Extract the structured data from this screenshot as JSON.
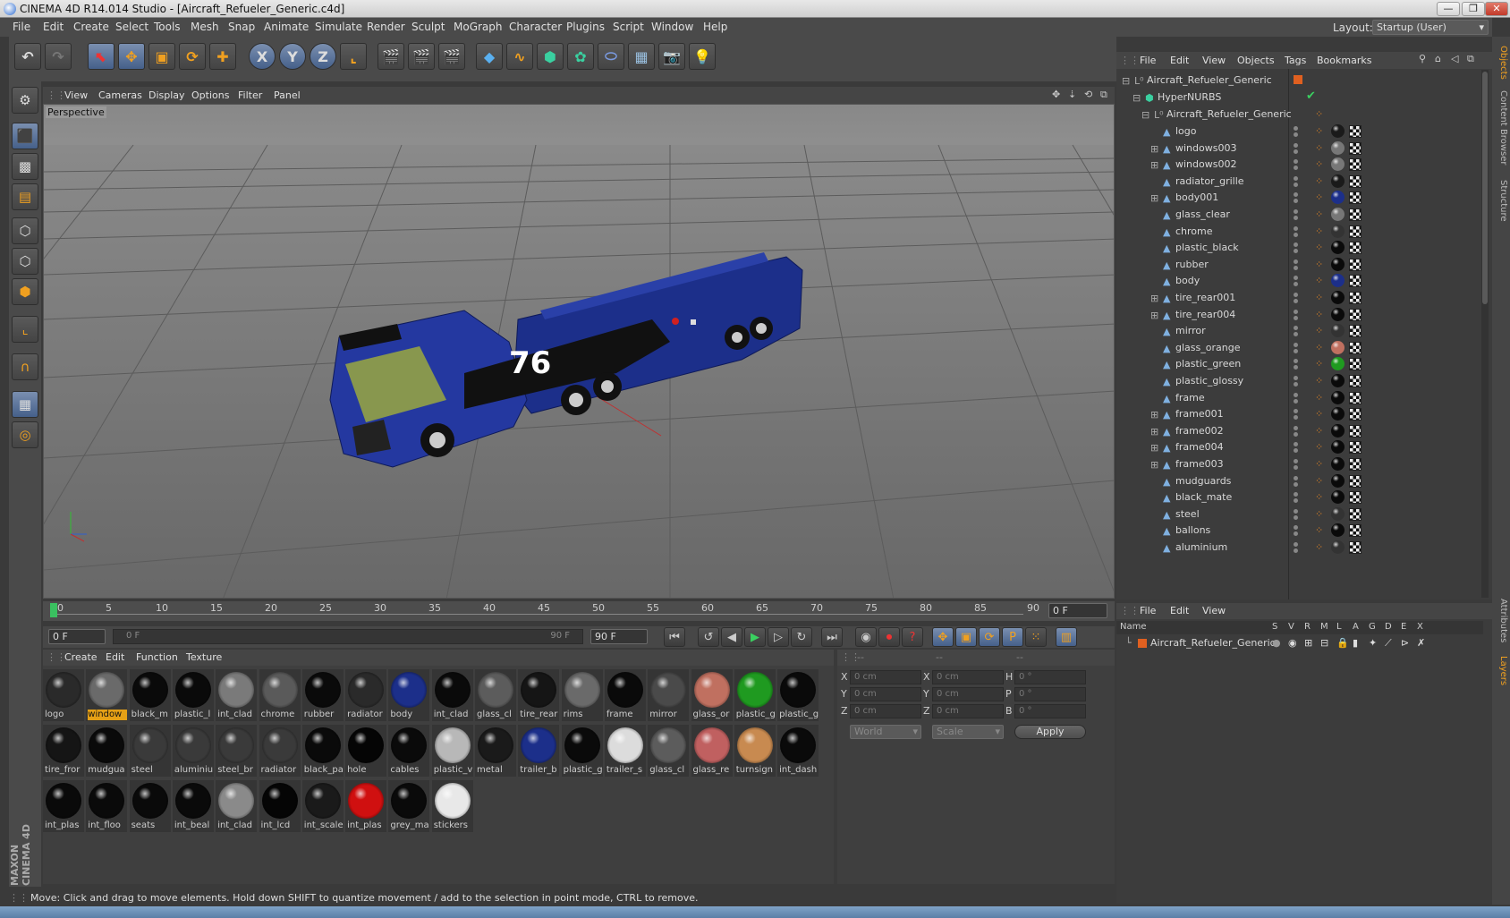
{
  "window": {
    "title": "CINEMA 4D R14.014 Studio - [Aircraft_Refueler_Generic.c4d]",
    "controls": [
      "—",
      "❐",
      "✕"
    ]
  },
  "menubar": {
    "items": [
      "File",
      "Edit",
      "Create",
      "Select",
      "Tools",
      "Mesh",
      "Snap",
      "Animate",
      "Simulate",
      "Render",
      "Sculpt",
      "MoGraph",
      "Character",
      "Plugins",
      "Script",
      "Window",
      "Help"
    ],
    "layout_label": "Layout:",
    "layout_value": "Startup (User)"
  },
  "toolbar": {
    "axis_x": "X",
    "axis_y": "Y",
    "axis_z": "Z"
  },
  "viewport": {
    "menu": [
      "View",
      "Cameras",
      "Display",
      "Options",
      "Filter",
      "Panel"
    ],
    "label": "Perspective",
    "truck_number": "76"
  },
  "timeline": {
    "ticks": [
      "0",
      "5",
      "10",
      "15",
      "20",
      "25",
      "30",
      "35",
      "40",
      "45",
      "50",
      "55",
      "60",
      "65",
      "70",
      "75",
      "80",
      "85",
      "90"
    ],
    "current_frame": "0 F",
    "start_field": "0 F",
    "range_start": "0 F",
    "range_end": "90 F",
    "end_field": "90 F"
  },
  "materials": {
    "menu": [
      "Create",
      "Edit",
      "Function",
      "Texture"
    ],
    "items": [
      {
        "label": "logo",
        "color": "#2a2a2a"
      },
      {
        "label": "window",
        "color": "#6a6a6a",
        "highlight": true
      },
      {
        "label": "black_m",
        "color": "#0a0a0a"
      },
      {
        "label": "plastic_l",
        "color": "#0a0a0a"
      },
      {
        "label": "int_clad",
        "color": "#7a7a7a"
      },
      {
        "label": "chrome",
        "color": "#5a5a5a"
      },
      {
        "label": "rubber",
        "color": "#0a0a0a"
      },
      {
        "label": "radiator",
        "color": "#2a2a2a"
      },
      {
        "label": "body",
        "color": "#1c2f8a"
      },
      {
        "label": "int_clad",
        "color": "#0a0a0a"
      },
      {
        "label": "glass_cl",
        "color": "#5c5c5c"
      },
      {
        "label": "tire_rear",
        "color": "#151515"
      },
      {
        "label": "rims",
        "color": "#6a6a6a"
      },
      {
        "label": "frame",
        "color": "#0a0a0a"
      },
      {
        "label": "mirror",
        "color": "#4a4a4a"
      },
      {
        "label": "glass_or",
        "color": "#c07060"
      },
      {
        "label": "plastic_g",
        "color": "#1f9a20"
      },
      {
        "label": "plastic_g",
        "color": "#0a0a0a"
      },
      {
        "label": "tire_fror",
        "color": "#151515"
      },
      {
        "label": "mudgua",
        "color": "#0a0a0a"
      },
      {
        "label": "steel",
        "color": "#3a3a3a"
      },
      {
        "label": "aluminiu",
        "color": "#3a3a3a"
      },
      {
        "label": "steel_br",
        "color": "#3a3a3a"
      },
      {
        "label": "radiator",
        "color": "#3a3a3a"
      },
      {
        "label": "black_pa",
        "color": "#0a0a0a"
      },
      {
        "label": "hole",
        "color": "#050505"
      },
      {
        "label": "cables",
        "color": "#0a0a0a"
      },
      {
        "label": "plastic_v",
        "color": "#b8b8b8"
      },
      {
        "label": "metal",
        "color": "#1a1a1a"
      },
      {
        "label": "trailer_b",
        "color": "#1c2f8a"
      },
      {
        "label": "plastic_g",
        "color": "#0a0a0a"
      },
      {
        "label": "trailer_s",
        "color": "#dcdcdc"
      },
      {
        "label": "glass_cl",
        "color": "#5c5c5c"
      },
      {
        "label": "glass_re",
        "color": "#c06060"
      },
      {
        "label": "turnsign",
        "color": "#c88a50"
      },
      {
        "label": "int_dash",
        "color": "#0a0a0a"
      },
      {
        "label": "int_plas",
        "color": "#0a0a0a"
      },
      {
        "label": "int_floo",
        "color": "#0a0a0a"
      },
      {
        "label": "seats",
        "color": "#0a0a0a"
      },
      {
        "label": "int_beal",
        "color": "#0a0a0a"
      },
      {
        "label": "int_clad",
        "color": "#8a8a8a"
      },
      {
        "label": "int_lcd",
        "color": "#050505"
      },
      {
        "label": "int_scale",
        "color": "#1a1a1a"
      },
      {
        "label": "int_plas",
        "color": "#d01010"
      },
      {
        "label": "grey_ma",
        "color": "#0a0a0a"
      },
      {
        "label": "stickers",
        "color": "#e8e8e8"
      }
    ]
  },
  "coordinates": {
    "headers": [
      "--",
      "--",
      "--"
    ],
    "rows": [
      {
        "a": "X",
        "av": "0 cm",
        "b": "X",
        "bv": "0 cm",
        "c": "H",
        "cv": "0 °"
      },
      {
        "a": "Y",
        "av": "0 cm",
        "b": "Y",
        "bv": "0 cm",
        "c": "P",
        "cv": "0 °"
      },
      {
        "a": "Z",
        "av": "0 cm",
        "b": "Z",
        "bv": "0 cm",
        "c": "B",
        "cv": "0 °"
      }
    ],
    "space": "World",
    "mode": "Scale",
    "apply": "Apply"
  },
  "objects": {
    "menu": [
      "File",
      "Edit",
      "View",
      "Objects",
      "Tags",
      "Bookmarks"
    ],
    "root": "Aircraft_Refueler_Generic",
    "hypernurbs": "HyperNURBS",
    "group": "Aircraft_Refueler_Generic",
    "items": [
      {
        "name": "logo",
        "tag": "#1a1a1a",
        "expand": false
      },
      {
        "name": "windows003",
        "tag": "#777",
        "expand": true
      },
      {
        "name": "windows002",
        "tag": "#777",
        "expand": true
      },
      {
        "name": "radiator_grille",
        "tag": "#1a1a1a",
        "expand": false
      },
      {
        "name": "body001",
        "tag": "#1c2f8a",
        "expand": true
      },
      {
        "name": "glass_clear",
        "tag": "#777",
        "expand": false
      },
      {
        "name": "chrome",
        "tag": "#333",
        "expand": false
      },
      {
        "name": "plastic_black",
        "tag": "#0a0a0a",
        "expand": false
      },
      {
        "name": "rubber",
        "tag": "#0a0a0a",
        "expand": false
      },
      {
        "name": "body",
        "tag": "#1c2f8a",
        "expand": false
      },
      {
        "name": "tire_rear001",
        "tag": "#0a0a0a",
        "expand": true
      },
      {
        "name": "tire_rear004",
        "tag": "#0a0a0a",
        "expand": true
      },
      {
        "name": "mirror",
        "tag": "#333",
        "expand": false
      },
      {
        "name": "glass_orange",
        "tag": "#c07060",
        "expand": false
      },
      {
        "name": "plastic_green",
        "tag": "#1f9a20",
        "expand": false
      },
      {
        "name": "plastic_glossy",
        "tag": "#0a0a0a",
        "expand": false
      },
      {
        "name": "frame",
        "tag": "#0a0a0a",
        "expand": false
      },
      {
        "name": "frame001",
        "tag": "#0a0a0a",
        "expand": true
      },
      {
        "name": "frame002",
        "tag": "#0a0a0a",
        "expand": true
      },
      {
        "name": "frame004",
        "tag": "#0a0a0a",
        "expand": true
      },
      {
        "name": "frame003",
        "tag": "#0a0a0a",
        "expand": true
      },
      {
        "name": "mudguards",
        "tag": "#0a0a0a",
        "expand": false
      },
      {
        "name": "black_mate",
        "tag": "#0a0a0a",
        "expand": false
      },
      {
        "name": "steel",
        "tag": "#333",
        "expand": false
      },
      {
        "name": "ballons",
        "tag": "#0a0a0a",
        "expand": false
      },
      {
        "name": "aluminium",
        "tag": "#333",
        "expand": false
      }
    ]
  },
  "layers": {
    "menu": [
      "File",
      "Edit",
      "View"
    ],
    "columns": [
      "Name",
      "S",
      "V",
      "R",
      "M",
      "L",
      "A",
      "G",
      "D",
      "E",
      "X"
    ],
    "row_name": "Aircraft_Refueler_Generic"
  },
  "right_tabs": [
    "Objects",
    "Content Browser",
    "Structure",
    "Attributes",
    "Layers"
  ],
  "maxon_logo": "MAXON CINEMA 4D",
  "status": "Move: Click and drag to move elements. Hold down SHIFT to quantize movement / add to the selection in point mode, CTRL to remove.",
  "colors": {
    "accent": "#e5a016",
    "selection_blue": "#45608a",
    "truck_blue": "#1c2f8a"
  }
}
